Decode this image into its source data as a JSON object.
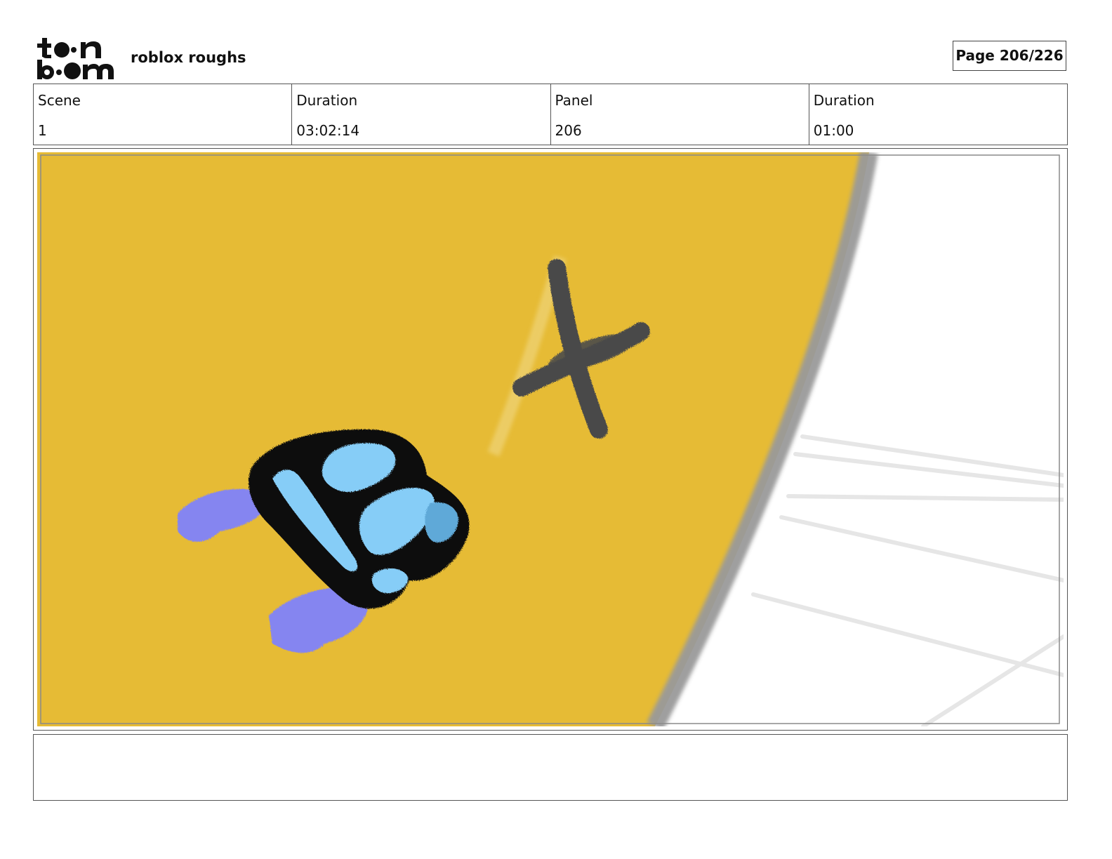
{
  "header": {
    "logo_name": "toon boom",
    "project_title": "roblox roughs",
    "page_indicator": "Page 206/226"
  },
  "info": {
    "scene_label": "Scene",
    "scene_value": "1",
    "scene_duration_label": "Duration",
    "scene_duration_value": "03:02:14",
    "panel_label": "Panel",
    "panel_value": "206",
    "panel_duration_label": "Duration",
    "panel_duration_value": "01:00"
  },
  "panel": {
    "floor_color": "#E6BB35",
    "rim_color": "#9A9A9A",
    "character_body_color": "#86CDF7",
    "character_outline_color": "#111111",
    "character_feet_color": "#8585F0",
    "shadow_marker_color": "#4A4A4A"
  },
  "notes": {
    "text": ""
  }
}
